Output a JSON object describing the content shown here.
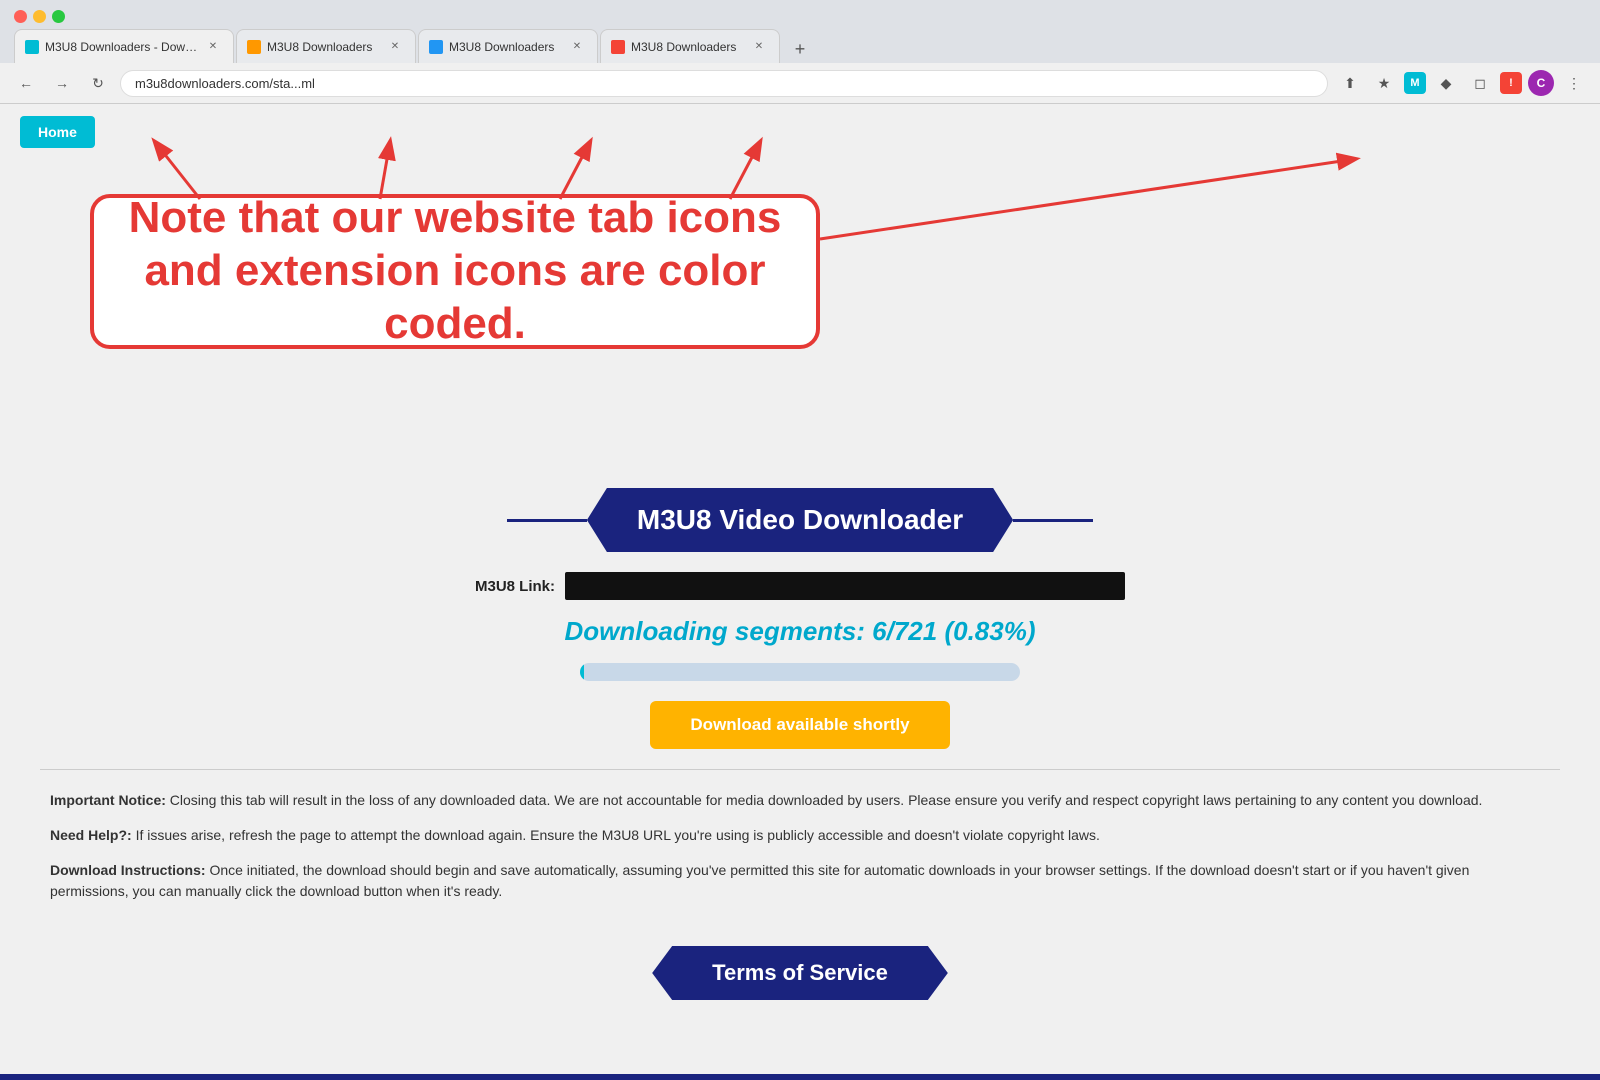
{
  "browser": {
    "tabs": [
      {
        "id": 1,
        "title": "M3U8 Downloaders - Downlo...",
        "favicon_color": "teal",
        "active": true
      },
      {
        "id": 2,
        "title": "M3U8 Downloaders",
        "favicon_color": "orange",
        "active": false
      },
      {
        "id": 3,
        "title": "M3U8 Downloaders",
        "favicon_color": "blue",
        "active": false
      },
      {
        "id": 4,
        "title": "M3U8 Downloaders",
        "favicon_color": "red",
        "active": false
      }
    ],
    "address": "m3u8downloaders.com/sta...ml",
    "new_tab_label": "+"
  },
  "annotation": {
    "text": "Note that our website tab icons and extension icons are color coded."
  },
  "nav": {
    "home_label": "Home"
  },
  "title": {
    "label": "M3U8 Video Downloader"
  },
  "form": {
    "m3u8_label": "M3U8 Link:",
    "m3u8_value": ""
  },
  "status": {
    "text": "Downloading segments: 6/721 (0.83%)",
    "progress_percent": 0.83
  },
  "download_button": {
    "label": "Download available shortly"
  },
  "notices": {
    "important_label": "Important Notice:",
    "important_text": " Closing this tab will result in the loss of any downloaded data. We are not accountable for media downloaded by users. Please ensure you verify and respect copyright laws pertaining to any content you download.",
    "help_label": "Need Help?:",
    "help_text": " If issues arise, refresh the page to attempt the download again. Ensure the M3U8 URL you're using is publicly accessible and doesn't violate copyright laws.",
    "instructions_label": "Download Instructions:",
    "instructions_text": " Once initiated, the download should begin and save automatically, assuming you've permitted this site for automatic downloads in your browser settings. If the download doesn't start or if you haven't given permissions, you can manually click the download button when it's ready."
  },
  "terms": {
    "label": "Terms of Service"
  }
}
